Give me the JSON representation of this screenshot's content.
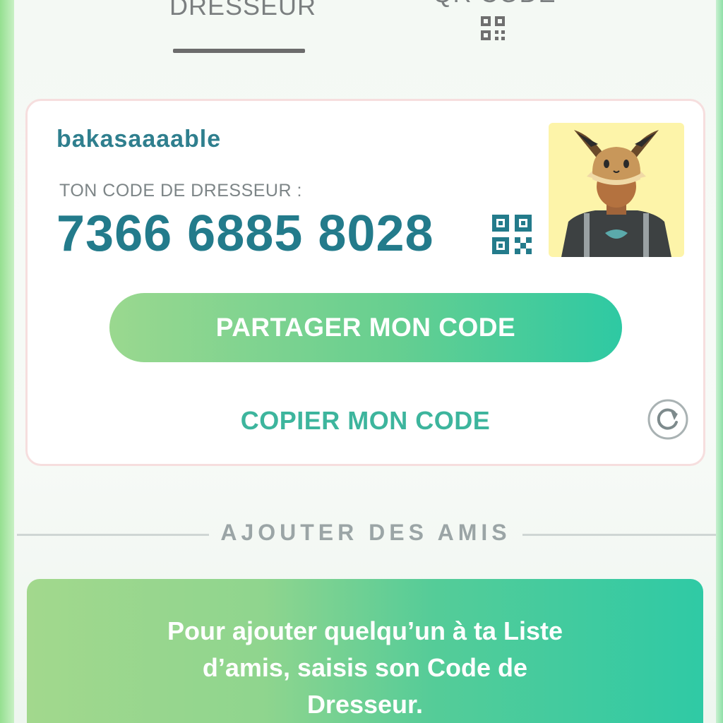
{
  "tabs": [
    {
      "label": "DRESSEUR",
      "active": true
    },
    {
      "label": "QR CODE",
      "active": false,
      "icon": "qr-code-icon"
    }
  ],
  "trainer_card": {
    "username": "bakasaaaable",
    "code_label": "TON CODE DE DRESSEUR :",
    "code_value": "7366 6885 8028",
    "qr_icon": "qr-code-icon",
    "avatar": "trainer-avatar"
  },
  "actions": {
    "share_label": "PARTAGER MON CODE",
    "copy_label": "COPIER MON CODE",
    "refresh_icon": "refresh-icon"
  },
  "add_friends": {
    "section_title": "AJOUTER DES AMIS",
    "info_text": "Pour ajouter quelqu’un à ta Liste d’amis, saisis son Code de Dresseur."
  },
  "colors": {
    "accent_teal": "#237b8b",
    "button_green_start": "#9ad88f",
    "button_green_end": "#2ec9a3",
    "copy_text": "#3db59d"
  }
}
